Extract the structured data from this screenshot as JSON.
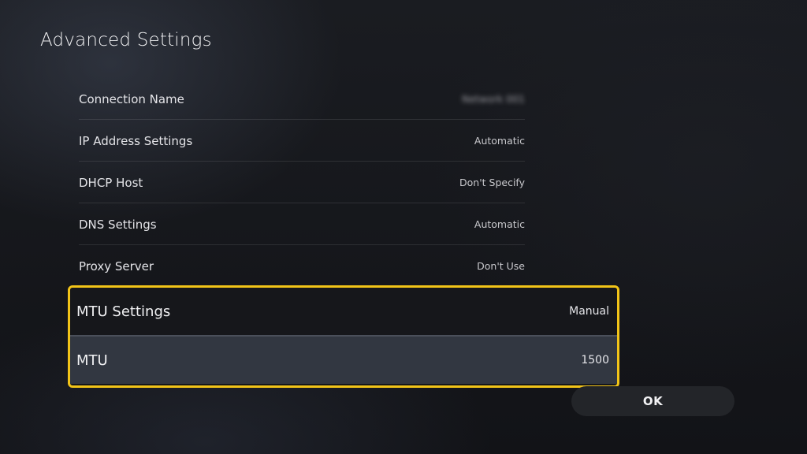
{
  "page": {
    "title": "Advanced Settings"
  },
  "settings": [
    {
      "label": "Connection Name",
      "value": "Network 001",
      "blurred": true
    },
    {
      "label": "IP Address Settings",
      "value": "Automatic"
    },
    {
      "label": "DHCP Host",
      "value": "Don't Specify"
    },
    {
      "label": "DNS Settings",
      "value": "Automatic"
    },
    {
      "label": "Proxy Server",
      "value": "Don't Use"
    }
  ],
  "focused_settings": [
    {
      "label": "MTU Settings",
      "value": "Manual"
    },
    {
      "label": "MTU",
      "value": "1500"
    }
  ],
  "actions": {
    "ok_label": "OK"
  },
  "colors": {
    "focus_border": "#f2c418",
    "selected_row": "#323741",
    "background": "#15171b"
  }
}
